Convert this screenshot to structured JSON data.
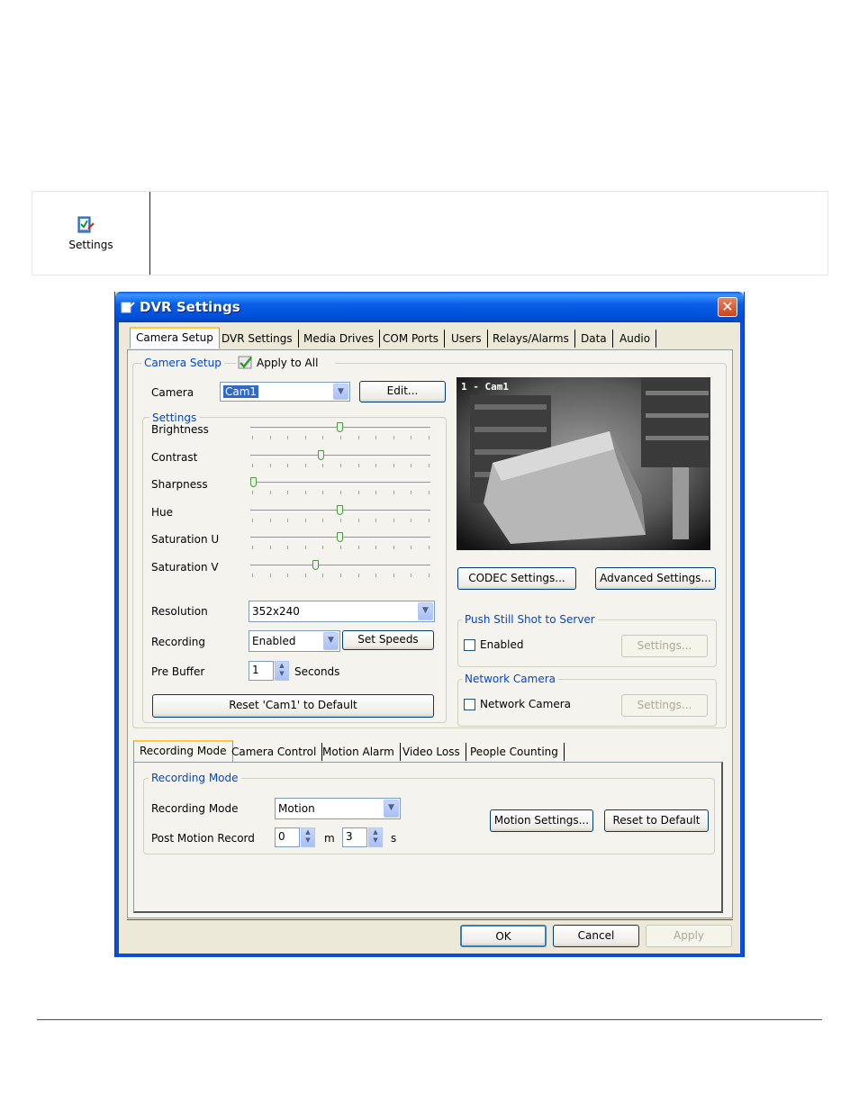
{
  "info": {
    "icon_name": "settings-icon",
    "label": "Settings"
  },
  "window": {
    "title": "DVR Settings",
    "close_glyph": "✕",
    "tabs": [
      "Camera Setup",
      "DVR Settings",
      "Media Drives",
      "COM Ports",
      "Users",
      "Relays/Alarms",
      "Data",
      "Audio"
    ],
    "active_tab": "Camera Setup"
  },
  "camera_setup": {
    "group_label": "Camera Setup",
    "apply_all_label": "Apply to All",
    "camera_label": "Camera",
    "camera_value": "Cam1",
    "edit_button": "Edit...",
    "settings_group": "Settings",
    "sliders": [
      {
        "label": "Brightness",
        "level": 0.5
      },
      {
        "label": "Contrast",
        "level": 0.39
      },
      {
        "label": "Sharpness",
        "level": 0.0
      },
      {
        "label": "Hue",
        "level": 0.5
      },
      {
        "label": "Saturation U",
        "level": 0.5
      },
      {
        "label": "Saturation V",
        "level": 0.36
      }
    ],
    "resolution_label": "Resolution",
    "resolution_value": "352x240",
    "recording_label": "Recording",
    "recording_value": "Enabled",
    "set_speeds_button": "Set Speeds",
    "prebuffer_label": "Pre Buffer",
    "prebuffer_value": "1",
    "prebuffer_unit": "Seconds",
    "reset_button": "Reset 'Cam1' to Default",
    "preview_label": "1 - Cam1",
    "codec_button": "CODEC Settings...",
    "advanced_button": "Advanced Settings...",
    "push_group": "Push Still Shot to Server",
    "push_enabled_label": "Enabled",
    "push_settings_button": "Settings...",
    "network_group": "Network Camera",
    "network_checkbox_label": "Network Camera",
    "network_settings_button": "Settings..."
  },
  "lower": {
    "tabs": [
      "Recording Mode",
      "Camera Control",
      "Motion Alarm",
      "Video Loss",
      "People Counting"
    ],
    "active_tab": "Recording Mode",
    "group_label": "Recording Mode",
    "mode_label": "Recording Mode",
    "mode_value": "Motion",
    "post_label": "Post Motion Record",
    "post_minutes": "0",
    "minutes_unit": "m",
    "post_seconds": "3",
    "seconds_unit": "s",
    "motion_settings_button": "Motion Settings...",
    "reset_default_button": "Reset to Default"
  },
  "footer": {
    "ok": "OK",
    "cancel": "Cancel",
    "apply": "Apply"
  },
  "colors": {
    "title_blue": "#0a5fe8",
    "face": "#ece9d8",
    "group_label": "#0046d5",
    "close_red": "#c8451d"
  }
}
